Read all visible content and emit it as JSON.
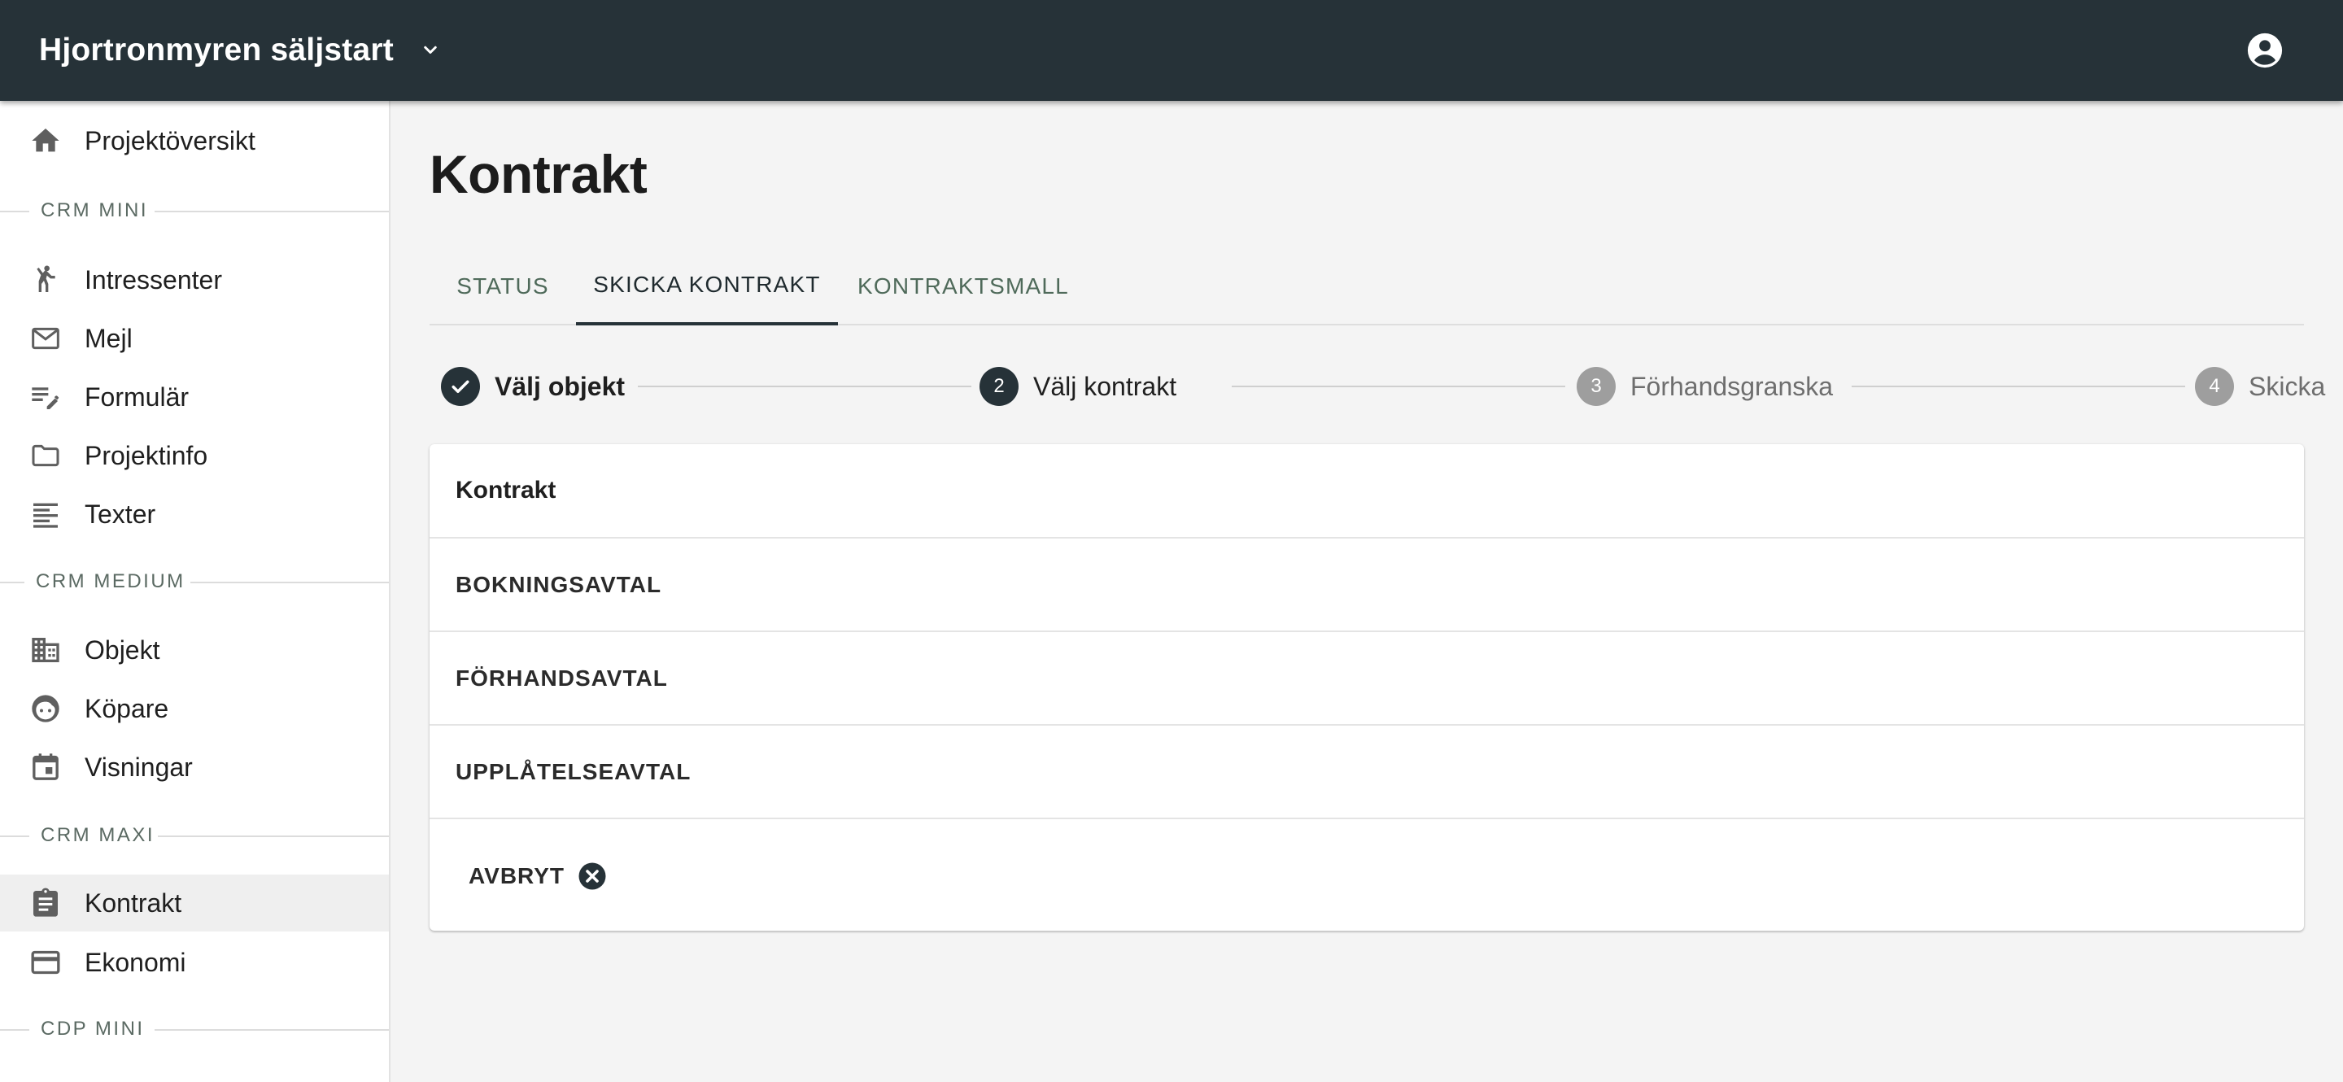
{
  "header": {
    "app_title": "Hjortronmyren säljstart",
    "bar_color": "#263238"
  },
  "sidebar": {
    "top_item": {
      "label": "Projektöversikt",
      "icon": "home-icon"
    },
    "sections": [
      {
        "title": "CRM MINI",
        "items": [
          {
            "label": "Intressenter",
            "icon": "person-waving-icon"
          },
          {
            "label": "Mejl",
            "icon": "mail-icon"
          },
          {
            "label": "Formulär",
            "icon": "form-edit-icon"
          },
          {
            "label": "Projektinfo",
            "icon": "folder-icon"
          },
          {
            "label": "Texter",
            "icon": "text-lines-icon"
          }
        ]
      },
      {
        "title": "CRM MEDIUM",
        "items": [
          {
            "label": "Objekt",
            "icon": "building-icon"
          },
          {
            "label": "Köpare",
            "icon": "face-icon"
          },
          {
            "label": "Visningar",
            "icon": "calendar-icon"
          }
        ]
      },
      {
        "title": "CRM MAXI",
        "items": [
          {
            "label": "Kontrakt",
            "icon": "clipboard-icon",
            "active": true
          },
          {
            "label": "Ekonomi",
            "icon": "credit-card-icon"
          }
        ]
      },
      {
        "title": "CDP MINI",
        "items": []
      }
    ]
  },
  "main": {
    "page_title": "Kontrakt",
    "tabs": [
      {
        "label": "STATUS"
      },
      {
        "label": "SKICKA KONTRAKT",
        "active": true
      },
      {
        "label": "KONTRAKTSMALL"
      }
    ],
    "stepper": [
      {
        "number": "1",
        "label": "Välj objekt",
        "state": "done"
      },
      {
        "number": "2",
        "label": "Välj kontrakt",
        "state": "current"
      },
      {
        "number": "3",
        "label": "Förhandsgranska",
        "state": "pending"
      },
      {
        "number": "4",
        "label": "Skicka",
        "state": "pending"
      }
    ],
    "card": {
      "header": "Kontrakt",
      "contracts": [
        "BOKNINGSAVTAL",
        "FÖRHANDSAVTAL",
        "UPPLÅTELSEAVTAL"
      ],
      "cancel_label": "AVBRYT"
    }
  }
}
